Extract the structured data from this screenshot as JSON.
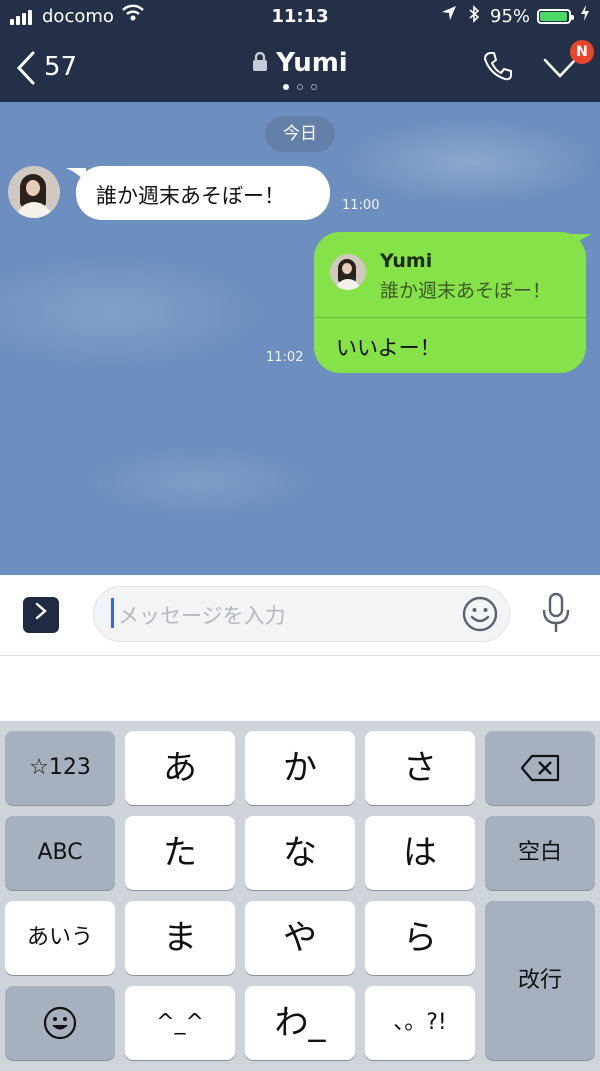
{
  "status": {
    "carrier": "docomo",
    "time": "11:13",
    "battery": "95%",
    "battery_level": 0.95
  },
  "header": {
    "back_count": "57",
    "title": "Yumi",
    "badge": "N"
  },
  "chat": {
    "date_label": "今日",
    "incoming": {
      "text": "誰か週末あそぼー！",
      "time": "11:00"
    },
    "outgoing": {
      "quote_name": "Yumi",
      "quote_text": "誰か週末あそぼー！",
      "text": "いいよー！",
      "time": "11:02"
    }
  },
  "composer": {
    "placeholder": "メッセージを入力"
  },
  "keyboard": {
    "row1": [
      "☆123",
      "あ",
      "か",
      "さ"
    ],
    "row2": [
      "ABC",
      "た",
      "な",
      "は",
      "空白"
    ],
    "row3": [
      "あいう",
      "ま",
      "や",
      "ら",
      "改行"
    ],
    "row4": [
      "^_^",
      "わ_",
      "、。?!"
    ]
  },
  "icons": {
    "back": "chevron-left-icon",
    "lock": "lock-icon",
    "phone": "phone-icon",
    "check": "check-icon",
    "plus": "expand-icon",
    "emoji": "smile-icon",
    "mic": "microphone-icon",
    "delete": "backspace-icon",
    "emoji_key": "emoji-icon"
  },
  "colors": {
    "header": "#233047",
    "outgoing_bubble": "#85e249",
    "chat_bg": "#6d8fbf",
    "badge": "#e8452c"
  }
}
